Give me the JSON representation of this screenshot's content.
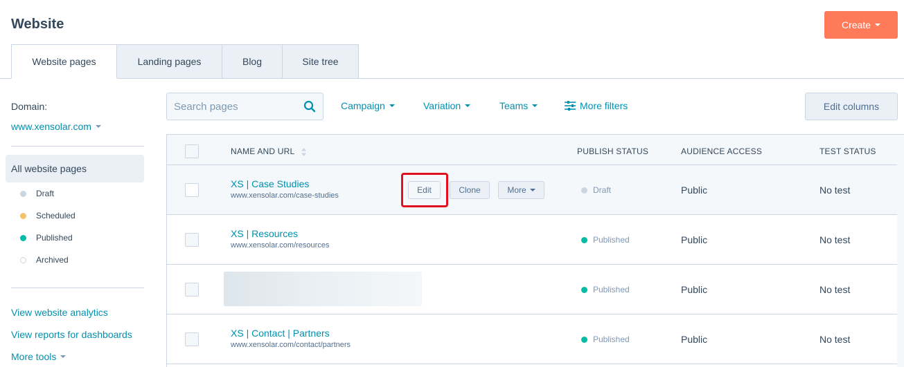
{
  "header": {
    "title": "Website",
    "create_label": "Create"
  },
  "tabs": [
    {
      "label": "Website pages",
      "active": true
    },
    {
      "label": "Landing pages",
      "active": false
    },
    {
      "label": "Blog",
      "active": false
    },
    {
      "label": "Site tree",
      "active": false
    }
  ],
  "sidebar": {
    "domain_label": "Domain:",
    "domain_value": "www.xensolar.com",
    "all_pages": "All website pages",
    "statuses": [
      {
        "label": "Draft",
        "color": "#cbd6e2"
      },
      {
        "label": "Scheduled",
        "color": "#f5c26b"
      },
      {
        "label": "Published",
        "color": "#00bda5"
      },
      {
        "label": "Archived",
        "color": "#ffffff"
      }
    ],
    "links": [
      "View website analytics",
      "View reports for dashboards",
      "More tools"
    ]
  },
  "toolbar": {
    "search_placeholder": "Search pages",
    "filters": [
      "Campaign",
      "Variation",
      "Teams"
    ],
    "more_filters": "More filters",
    "edit_columns": "Edit columns"
  },
  "table": {
    "columns": [
      "NAME AND URL",
      "PUBLISH STATUS",
      "AUDIENCE ACCESS",
      "TEST STATUS"
    ],
    "row_actions": {
      "edit": "Edit",
      "clone": "Clone",
      "more": "More"
    },
    "rows": [
      {
        "name": "XS | Case Studies",
        "url": "www.xensolar.com/case-studies",
        "status": "Draft",
        "status_color": "#cbd6e2",
        "access": "Public",
        "test": "No test"
      },
      {
        "name": "XS | Resources",
        "url": "www.xensolar.com/resources",
        "status": "Published",
        "status_color": "#00bda5",
        "access": "Public",
        "test": "No test"
      },
      {
        "name": "",
        "url": "",
        "status": "Published",
        "status_color": "#00bda5",
        "access": "Public",
        "test": "No test"
      },
      {
        "name": "XS | Contact | Partners",
        "url": "www.xensolar.com/contact/partners",
        "status": "Published",
        "status_color": "#00bda5",
        "access": "Public",
        "test": "No test"
      }
    ]
  },
  "colors": {
    "accent": "#ff7a59",
    "link": "#0091ae",
    "highlight": "#e0101f"
  }
}
